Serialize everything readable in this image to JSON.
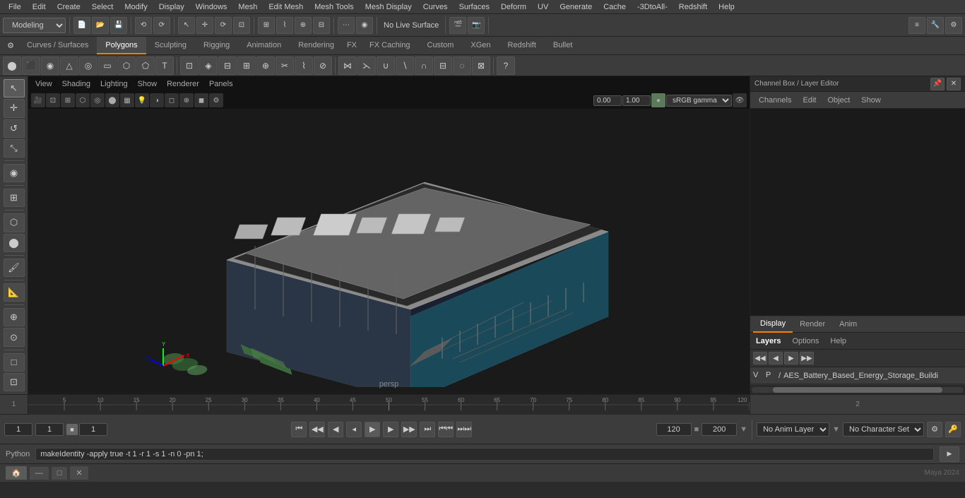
{
  "menu": {
    "items": [
      "File",
      "Edit",
      "Create",
      "Select",
      "Modify",
      "Display",
      "Windows",
      "Mesh",
      "Edit Mesh",
      "Mesh Tools",
      "Mesh Display",
      "Curves",
      "Surfaces",
      "Deform",
      "UV",
      "Generate",
      "Cache",
      "-3DtoAll-",
      "Redshift",
      "Help"
    ]
  },
  "toolbar1": {
    "mode_selector": "Modeling",
    "undo_label": "⟲",
    "redo_label": "⟳"
  },
  "tabs": {
    "items": [
      "Curves / Surfaces",
      "Polygons",
      "Sculpting",
      "Rigging",
      "Animation",
      "Rendering",
      "FX",
      "FX Caching",
      "Custom",
      "XGen",
      "Redshift",
      "Bullet"
    ],
    "active": "Polygons"
  },
  "shelf": {
    "settings_icon": "⚙"
  },
  "viewport": {
    "menu_items": [
      "View",
      "Shading",
      "Lighting",
      "Show",
      "Renderer",
      "Panels"
    ],
    "label": "persp",
    "gamma_value": "sRGB gamma",
    "field1": "0.00",
    "field2": "1.00",
    "camera_label": "No Live Surface"
  },
  "left_toolbar": {
    "tools": [
      "↖",
      "↔",
      "⟳",
      "↕",
      "⬡",
      "◎",
      "□",
      "⊕",
      "⊞",
      "⬛"
    ]
  },
  "right_panel": {
    "header": "Channel Box / Layer Editor",
    "tabs": [
      "Display",
      "Render",
      "Anim"
    ],
    "active_tab": "Display",
    "subtabs": [
      "Channels",
      "Edit",
      "Object",
      "Show"
    ],
    "layers_label": "Layers",
    "options_label": "Options",
    "help_label": "Help",
    "layer_name": "AES_Battery_Based_Energy_Storage_Buildi",
    "layer_v": "V",
    "layer_p": "P"
  },
  "timeline": {
    "start": "1",
    "end": "120",
    "ticks": [
      "1",
      "5",
      "10",
      "15",
      "20",
      "25",
      "30",
      "35",
      "40",
      "45",
      "50",
      "55",
      "60",
      "65",
      "70",
      "75",
      "80",
      "85",
      "90",
      "95",
      "100",
      "105",
      "110",
      "115",
      "120"
    ]
  },
  "transport": {
    "frame_start": "1",
    "frame_current": "1",
    "anim_start": "1",
    "anim_end": "120",
    "range_end": "200",
    "no_anim_layer": "No Anim Layer",
    "no_char_set": "No Character Set",
    "btns": [
      "⏮",
      "◀◀",
      "◀",
      "▶",
      "▶▶",
      "⏭",
      "⏮⏮",
      "⏭⏭"
    ]
  },
  "status_bar": {
    "python_label": "Python",
    "cmd_value": "makeIdentity -apply true -t 1 -r 1 -s 1 -n 0 -pn 1;"
  },
  "bottom": {
    "left_icon": "🏠",
    "minimize": "—",
    "restore": "□",
    "close": "✕"
  }
}
